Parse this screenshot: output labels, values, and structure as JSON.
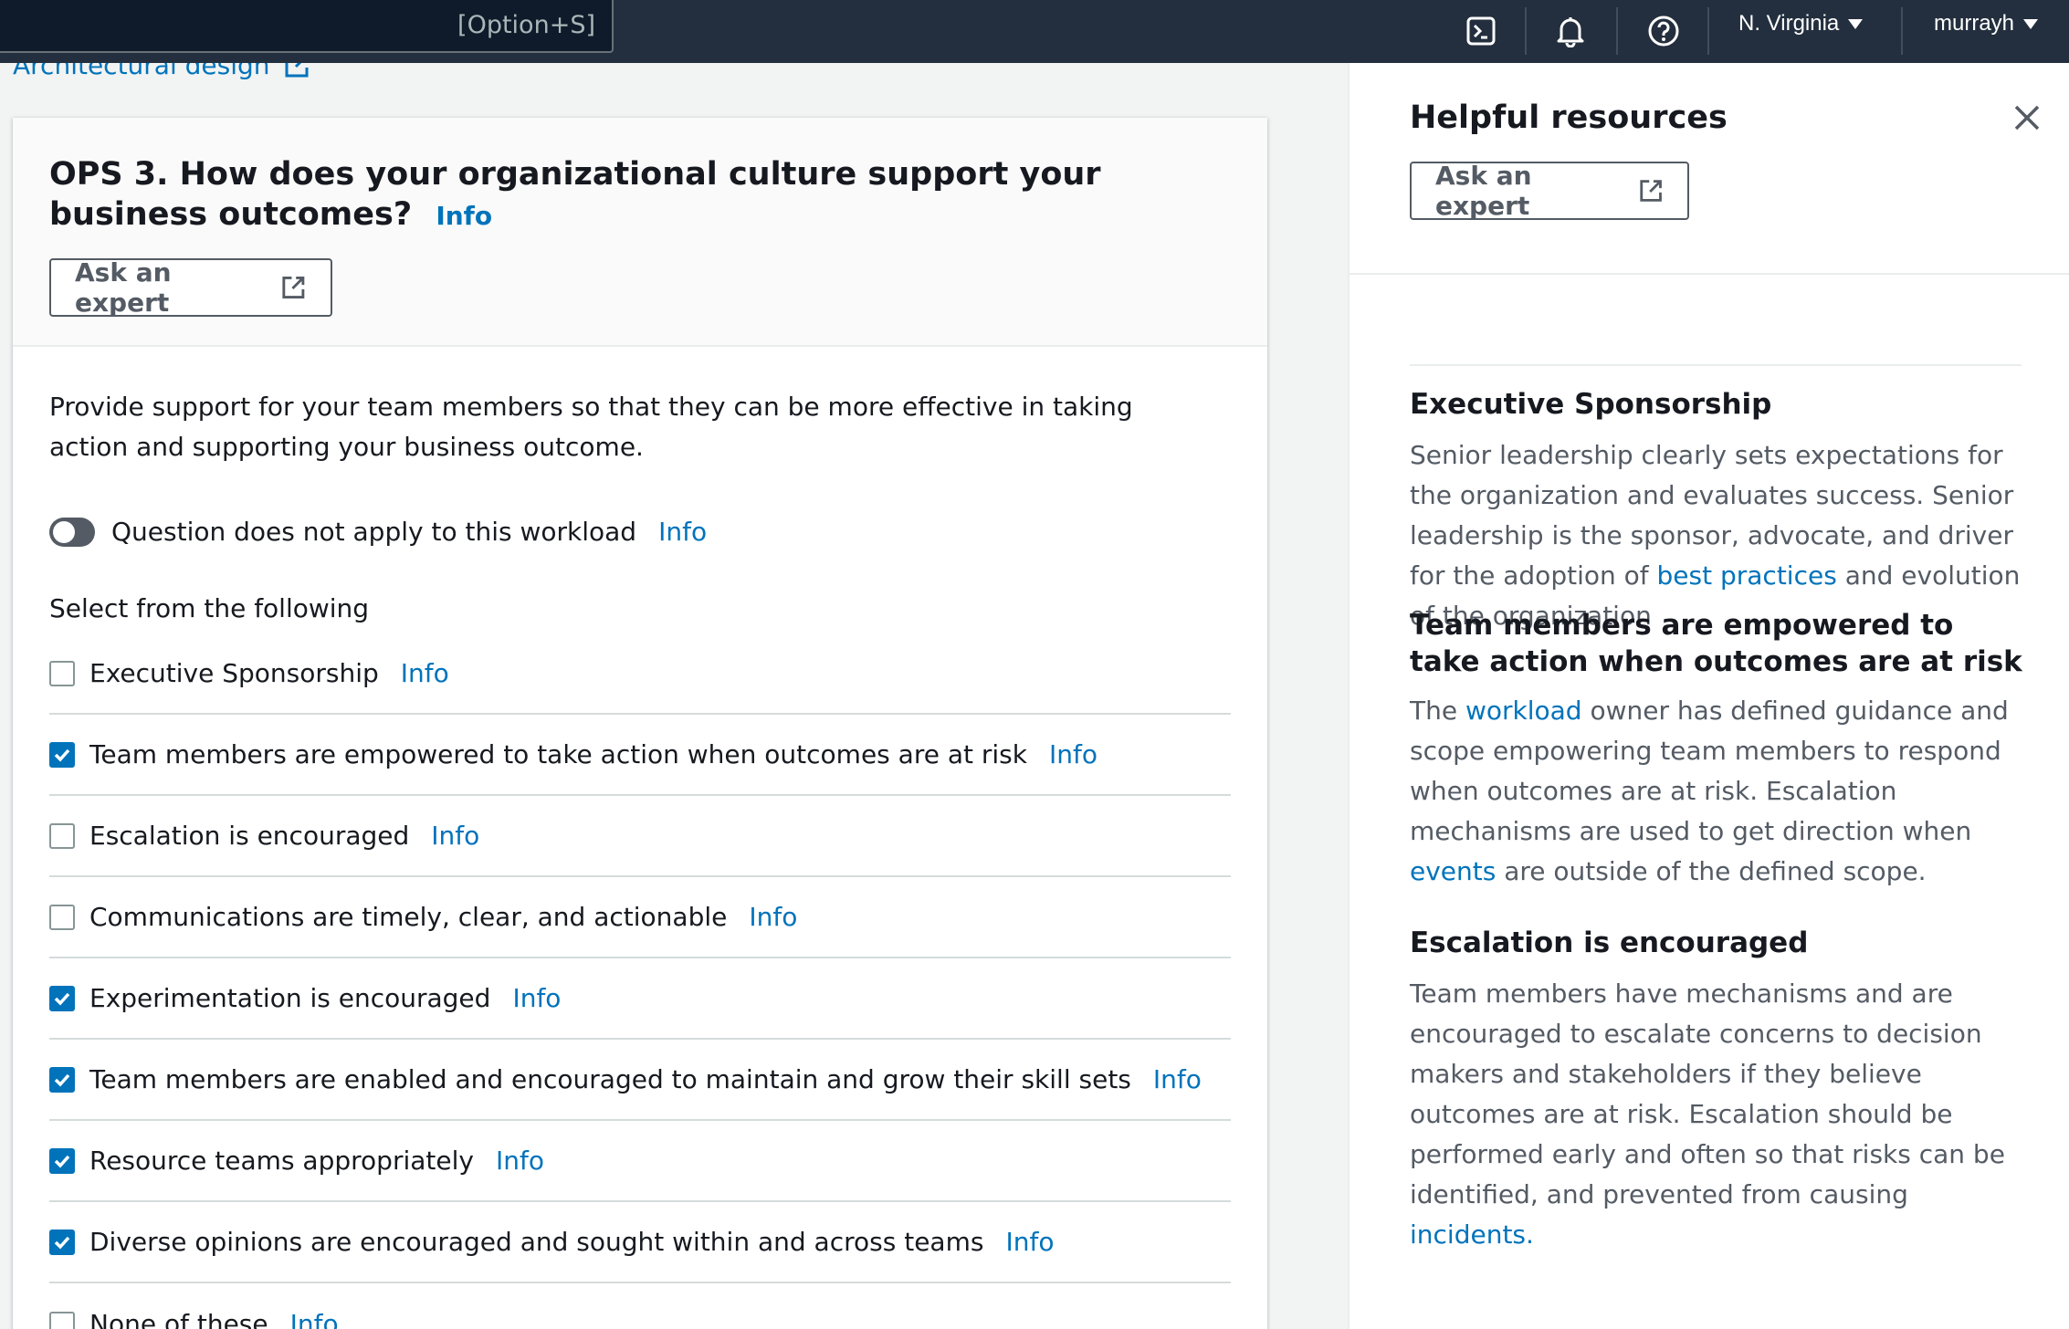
{
  "topbar": {
    "search_shortcut": "[Option+S]",
    "region": "N. Virginia",
    "user": "murrayh",
    "icons": [
      "cloudshell-icon",
      "bell-icon",
      "help-icon"
    ]
  },
  "main": {
    "arch_link": "Architectural design",
    "question": {
      "title": "OPS 3. How does your organizational culture support your business outcomes?",
      "info": "Info",
      "ask_expert": "Ask an expert",
      "description": "Provide support for your team members so that they can be more effective in taking action and supporting your business outcome.",
      "toggle_label": "Question does not apply to this workload",
      "toggle_info": "Info",
      "toggle_on": false,
      "select_label": "Select from the following",
      "options": [
        {
          "label": "Executive Sponsorship",
          "info": "Info",
          "checked": false
        },
        {
          "label": "Team members are empowered to take action when outcomes are at risk",
          "info": "Info",
          "checked": true
        },
        {
          "label": "Escalation is encouraged",
          "info": "Info",
          "checked": false
        },
        {
          "label": "Communications are timely, clear, and actionable",
          "info": "Info",
          "checked": false
        },
        {
          "label": "Experimentation is encouraged",
          "info": "Info",
          "checked": true
        },
        {
          "label": "Team members are enabled and encouraged to maintain and grow their skill sets",
          "info": "Info",
          "checked": true
        },
        {
          "label": "Resource teams appropriately",
          "info": "Info",
          "checked": true
        },
        {
          "label": "Diverse opinions are encouraged and sought within and across teams",
          "info": "Info",
          "checked": true
        },
        {
          "label": "None of these",
          "info": "Info",
          "checked": false
        }
      ]
    }
  },
  "panel": {
    "title": "Helpful resources",
    "ask_expert": "Ask an expert",
    "resources": [
      {
        "title": "Executive Sponsorship",
        "text_parts": [
          {
            "t": "Senior leadership clearly sets expectations for the organization and evaluates success. Senior leadership is the sponsor, advocate, and driver for the adoption of "
          },
          {
            "t": "best practices",
            "link": true
          },
          {
            "t": " and evolution of the organization"
          }
        ]
      },
      {
        "title": "Team members are empowered to take action when outcomes are at risk",
        "text_parts": [
          {
            "t": "The "
          },
          {
            "t": "workload",
            "link": true
          },
          {
            "t": " owner has defined guidance and scope empowering team members to respond when outcomes are at risk. Escalation mechanisms are used to get direction when "
          },
          {
            "t": "events",
            "link": true
          },
          {
            "t": " are outside of the defined scope."
          }
        ]
      },
      {
        "title": "Escalation is encouraged",
        "text_parts": [
          {
            "t": "Team members have mechanisms and are encouraged to escalate concerns to decision makers and stakeholders if they believe outcomes are at risk. Escalation should be performed early and often so that risks can be identified, and prevented from causing "
          },
          {
            "t": "incidents.",
            "link": true
          }
        ]
      }
    ]
  },
  "colors": {
    "topbar": "#232f3e",
    "link": "#0073bb",
    "checkbox_checked": "#0073bb"
  }
}
